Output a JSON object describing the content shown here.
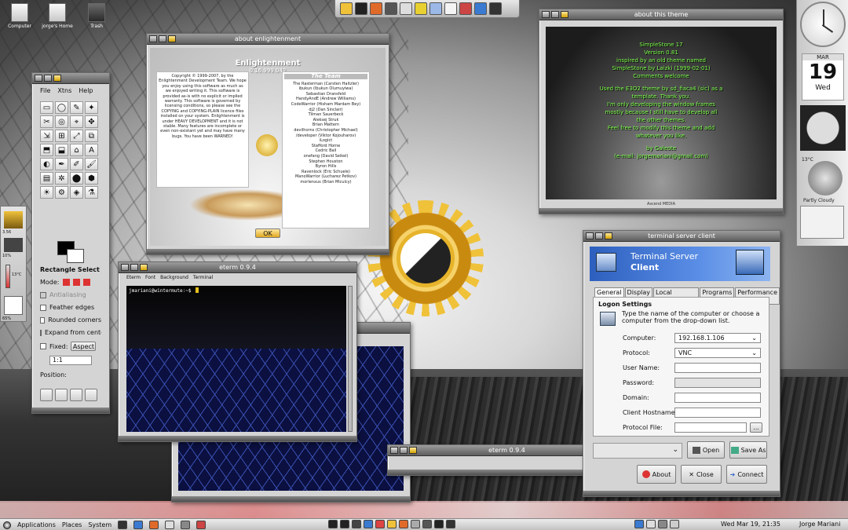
{
  "desktop": {
    "icons": [
      "Computer",
      "jorge's Home",
      "Trash"
    ]
  },
  "about_enlightenment": {
    "title": "about enlightenment",
    "heading": "Enlightenment",
    "version": "0.16.999.042",
    "left_text": "Copyright © 1999-2007, by the Enlightenment Development Team. We hope you enjoy using this software as much as we enjoyed writing it. This software is provided as-is with no explicit or implied warranty. This software is governed by licensing conditions, so please see the COPYING and COPYING-PLAIN licence files installed on your system. Enlightenment is under HEAVY DEVELOPMENT and it is not stable. Many features are incomplete or even non-existant yet and may have many bugs. You have been WARNED!",
    "team_heading": "The Team",
    "team": [
      "The Rasterman (Carsten Haitzler)",
      "ibukun (Ibukun Olumuyiwa)",
      "Sebastian Dransfeld",
      "HandyAndE (Andrew Williams)",
      "CodeWarrior (Hisham Mardam Bey)",
      "dj2 (Dan Sinclair)",
      "Tilman Sauerbeck",
      "Aleksej Struk",
      "Brian Mattern",
      "devilhorns (Christopher Michael)",
      "/developer (Viktor Kojouharov)",
      "iLogict",
      "Stafford Horne",
      "Cedric Bail",
      "onefang (David Seikel)",
      "Stephen Houston",
      "Byron Hills",
      "Ravenlock (Eric Schuele)",
      "ManoWarrior (Lucharez Petkov)",
      "morlenxus (Brian Miculcy)"
    ],
    "ok_label": "OK"
  },
  "gimp": {
    "menu": [
      "File",
      "Xtns",
      "Help"
    ],
    "tools": [
      "▭",
      "◯",
      "✎",
      "✦",
      "✂",
      "◎",
      "⌖",
      "✥",
      "⇲",
      "⊞",
      "⤢",
      "⧉",
      "⬒",
      "⬓",
      "⌂",
      "A",
      "◐",
      "✒",
      "✐",
      "🖌",
      "▤",
      "✲",
      "⬤",
      "⬢",
      "☀",
      "⚙",
      "◈",
      "⚗"
    ],
    "tool_options_title": "Rectangle Select",
    "mode_label": "Mode:",
    "options": [
      "Antialiasing",
      "Feather edges",
      "Rounded corners",
      "Expand from center",
      "Fixed:"
    ],
    "aspect_label": "Aspect",
    "ratio_value": "1:1",
    "position_label": "Position:"
  },
  "eterm_front": {
    "title": "eterm 0.9.4",
    "menu": [
      "Eterm",
      "Font",
      "Background",
      "Terminal"
    ],
    "prompt": "jmariani@wintermute:~$"
  },
  "eterm_min": {
    "title": "eterm 0.9.4"
  },
  "about_theme": {
    "title": "about this theme",
    "lines": [
      "SimpleStone 17",
      "Version 0.81",
      "inspired by an old theme named",
      "SimpleStone by Laizki (1999-02-01)",
      "Comments welcome",
      "",
      "Used the E3O2 theme by sd_fiaca4 (sic) as a",
      "template. Thank you.",
      "I'm only developing the window frames",
      "mostly because I still have to develop all",
      "the other themes.",
      "Feel free to modify this theme and add",
      "whatever you like.",
      "",
      "by Galeote",
      "(e-mail: jorgemariani@gmail.com)"
    ],
    "credit": "Ascend MEDIA"
  },
  "tsclient": {
    "title": "terminal server client",
    "banner_line1": "Terminal Server",
    "banner_line2": "Client",
    "tabs": [
      "General",
      "Display",
      "Local Resources",
      "Programs",
      "Performance"
    ],
    "section": "Logon Settings",
    "hint": "Type the name of the computer or choose a computer from the drop-down list.",
    "fields": [
      {
        "label": "Computer:",
        "value": "192.168.1.106"
      },
      {
        "label": "Protocol:",
        "value": "VNC"
      },
      {
        "label": "User Name:",
        "value": ""
      },
      {
        "label": "Password:",
        "value": ""
      },
      {
        "label": "Domain:",
        "value": ""
      },
      {
        "label": "Client Hostname:",
        "value": ""
      },
      {
        "label": "Protocol File:",
        "value": ""
      }
    ],
    "browse_label": "...",
    "open_label": "Open",
    "save_as_label": "Save As",
    "about_label": "About",
    "close_label": "Close",
    "connect_label": "Connect"
  },
  "dock": {
    "calendar_month": "MAR",
    "calendar_day": "19",
    "calendar_weekday": "Wed",
    "temp": "13°C",
    "weather_label": "Partly Cloudy"
  },
  "left_dock": {
    "labels": [
      "3.56",
      "10%",
      "65%",
      "13°C"
    ]
  },
  "panel": {
    "menu": [
      "Applications",
      "Places",
      "System"
    ],
    "clock": "Wed Mar 19, 21:35",
    "user": "Jorge Mariani"
  }
}
